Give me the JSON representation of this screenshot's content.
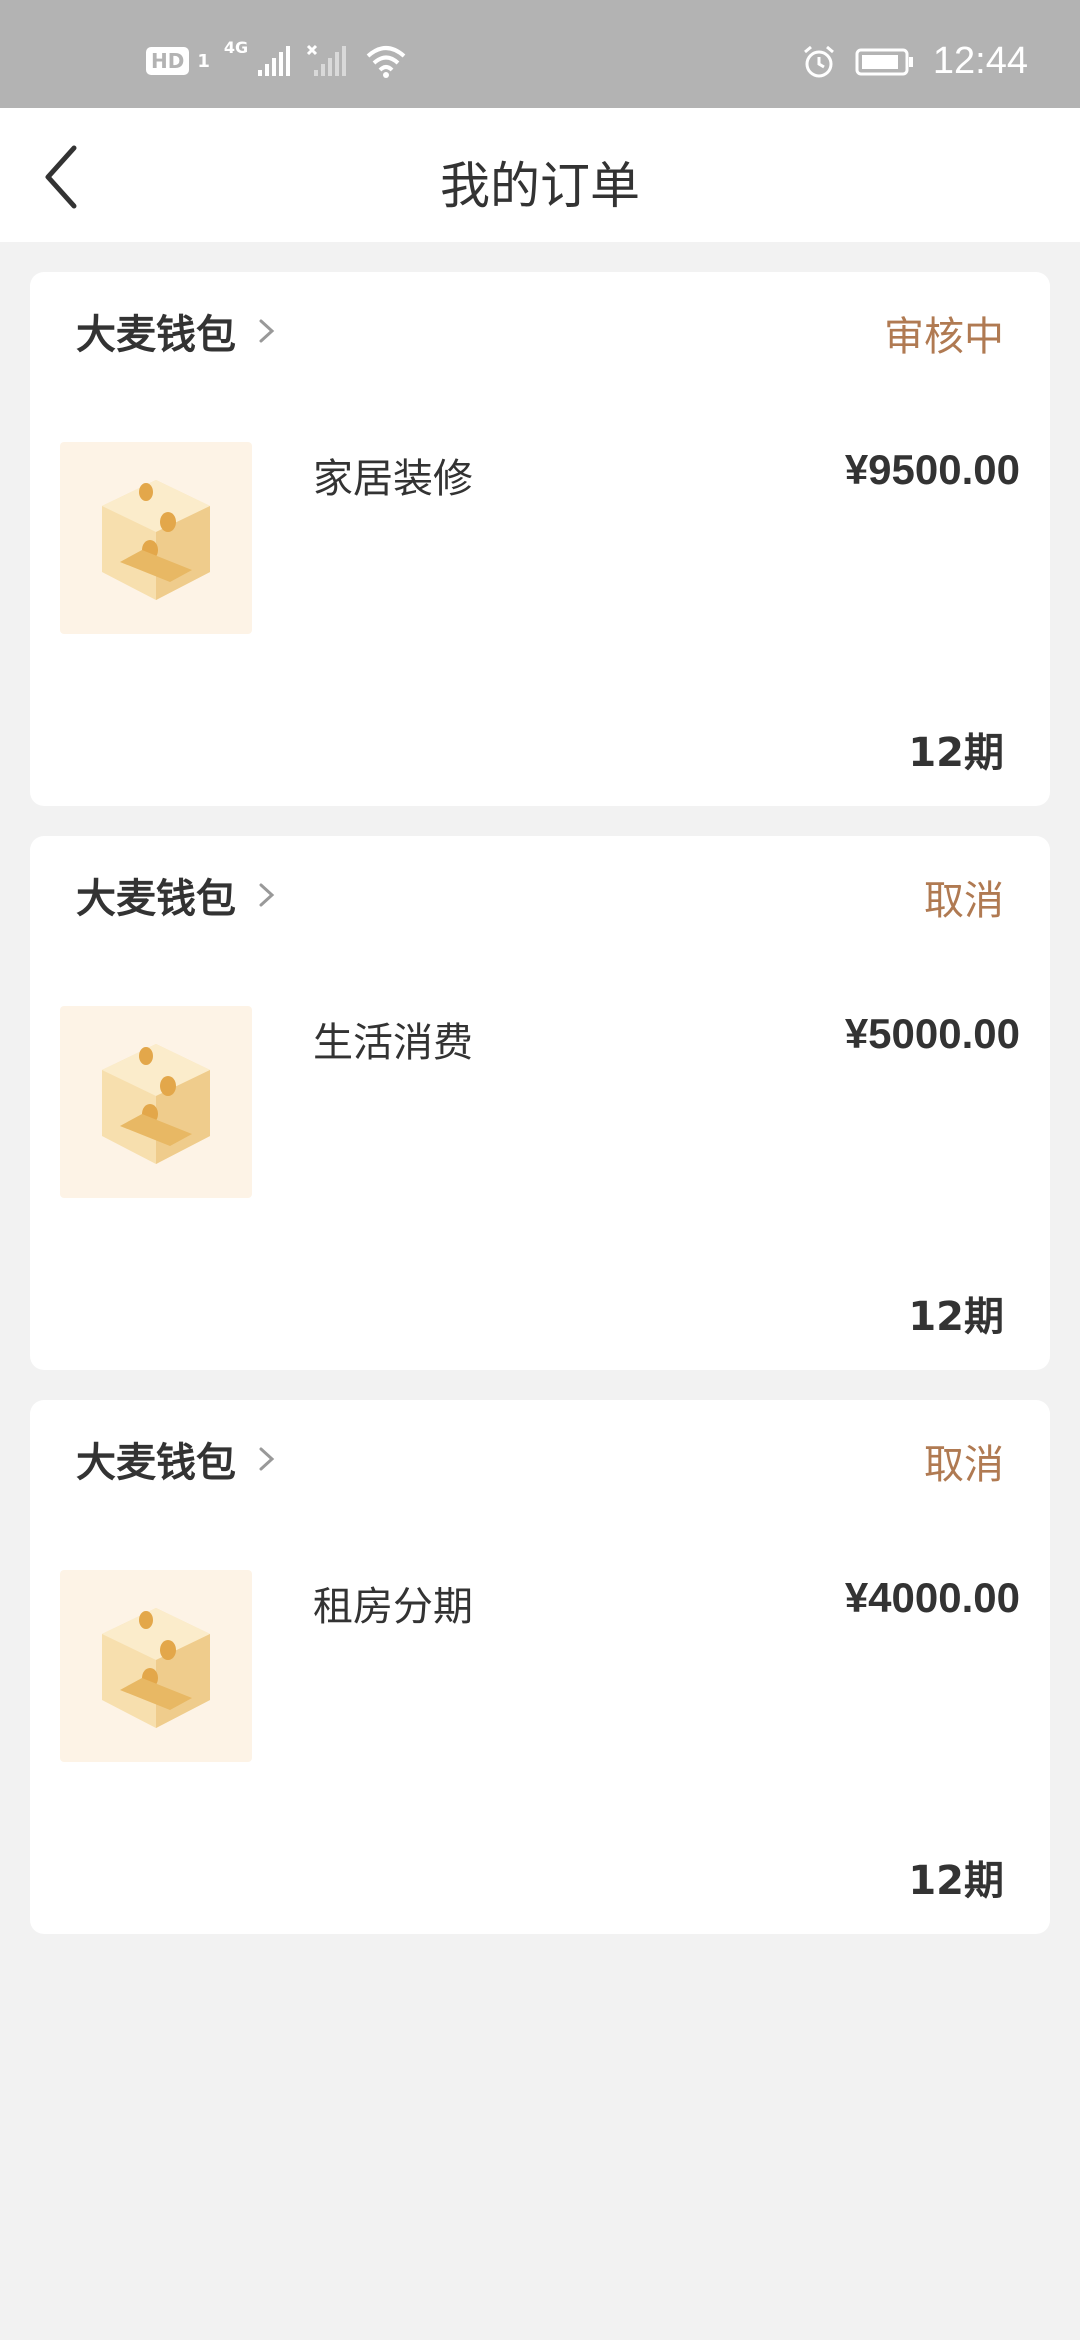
{
  "status_bar": {
    "network_badge": "HD",
    "sim_slot": "1",
    "network_type": "4G",
    "time": "12:44",
    "icons": [
      "hd-icon",
      "signal-icon",
      "no-signal-icon",
      "wifi-icon",
      "alarm-icon",
      "battery-icon"
    ]
  },
  "nav": {
    "title": "我的订单",
    "back_icon": "chevron-left-icon"
  },
  "orders": [
    {
      "merchant": "大麦钱包",
      "status": "审核中",
      "product": "家居装修",
      "price": "¥9500.00",
      "term": "12期"
    },
    {
      "merchant": "大麦钱包",
      "status": "取消",
      "product": "生活消费",
      "price": "¥5000.00",
      "term": "12期"
    },
    {
      "merchant": "大麦钱包",
      "status": "取消",
      "product": "租房分期",
      "price": "¥4000.00",
      "term": "12期"
    }
  ],
  "colors": {
    "status_bar_bg": "#b3b3b3",
    "page_bg": "#f2f2f2",
    "card_bg": "#ffffff",
    "status_accent": "#b07a52",
    "text_primary": "#333333",
    "thumb_bg": "#fdf3e6"
  }
}
